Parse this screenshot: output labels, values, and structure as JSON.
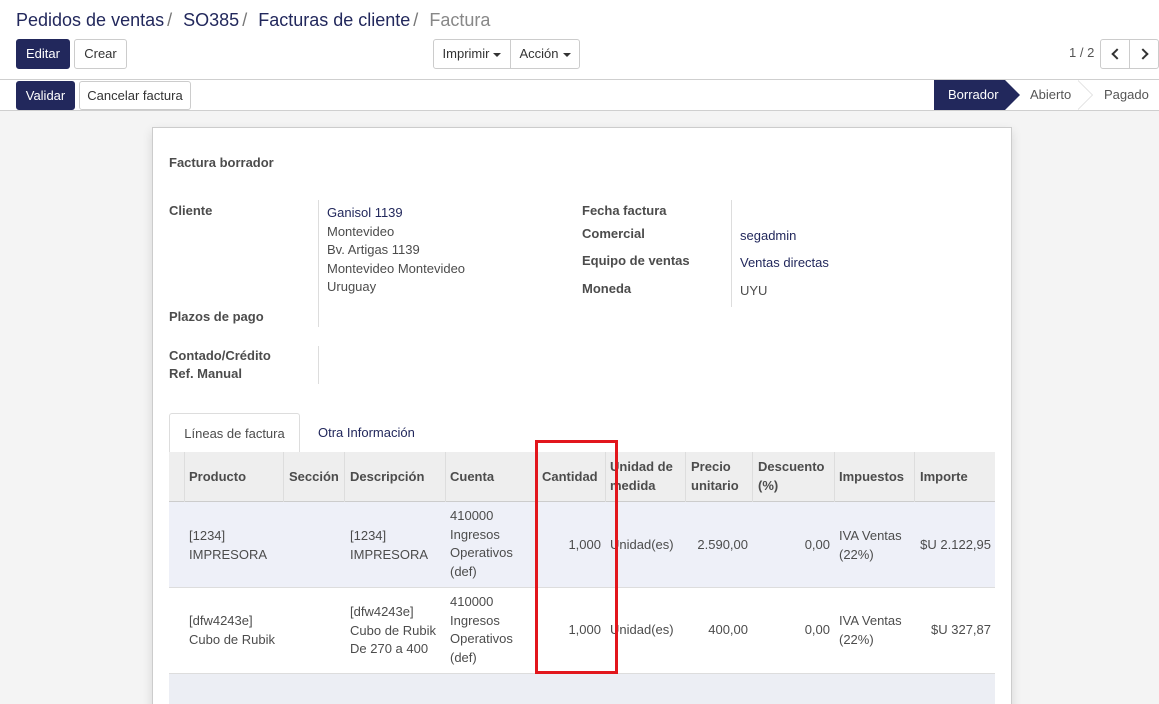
{
  "breadcrumb": {
    "items": [
      "Pedidos de ventas",
      "SO385",
      "Facturas de cliente"
    ],
    "current": "Factura"
  },
  "toolbar": {
    "edit_label": "Editar",
    "create_label": "Crear",
    "print_label": "Imprimir",
    "action_label": "Acción",
    "pager_value": "1 / 2"
  },
  "statusbar": {
    "validate_label": "Validar",
    "cancel_label": "Cancelar factura",
    "stages": [
      "Borrador",
      "Abierto",
      "Pagado"
    ],
    "active_stage": "Borrador"
  },
  "form": {
    "title": "Factura borrador",
    "cliente_label": "Cliente",
    "cliente_lines": [
      "Ganisol 1139",
      "Montevideo",
      "Bv. Artigas 1139",
      "Montevideo Montevideo",
      "Uruguay"
    ],
    "plazos_label": "Plazos de pago",
    "contado_label": "Contado/Crédito",
    "ref_label": "Ref. Manual",
    "fecha_label": "Fecha factura",
    "comercial_label": "Comercial",
    "comercial_value": "segadmin",
    "equipo_label": "Equipo de ventas",
    "equipo_value": "Ventas directas",
    "moneda_label": "Moneda",
    "moneda_value": "UYU"
  },
  "tabs": [
    "Líneas de factura",
    "Otra Información"
  ],
  "table": {
    "headers": {
      "producto": "Producto",
      "seccion": "Sección",
      "descripcion": "Descripción",
      "cuenta": "Cuenta",
      "cantidad": "Cantidad",
      "unidad_1": "Unidad de",
      "unidad_2": "medida",
      "precio_1": "Precio",
      "precio_2": "unitario",
      "descuento_1": "Descuento",
      "descuento_2": "(%)",
      "impuestos": "Impuestos",
      "importe": "Importe"
    },
    "rows": [
      {
        "producto": [
          "[1234]",
          "IMPRESORA"
        ],
        "seccion": "",
        "descripcion": [
          "[1234]",
          "IMPRESORA"
        ],
        "cuenta": [
          "410000",
          "Ingresos",
          "Operativos",
          "(def)"
        ],
        "cantidad": "1,000",
        "unidad": "Unidad(es)",
        "precio": "2.590,00",
        "descuento": "0,00",
        "impuestos": [
          "IVA Ventas",
          "(22%)"
        ],
        "importe": "$U 2.122,95"
      },
      {
        "producto": [
          "[dfw4243e]",
          "Cubo de Rubik"
        ],
        "seccion": "",
        "descripcion": [
          "[dfw4243e]",
          "Cubo de Rubik",
          "De 270 a 400"
        ],
        "cuenta": [
          "410000",
          "Ingresos",
          "Operativos",
          "(def)"
        ],
        "cantidad": "1,000",
        "unidad": "Unidad(es)",
        "precio": "400,00",
        "descuento": "0,00",
        "impuestos": [
          "IVA Ventas",
          "(22%)"
        ],
        "importe": "$U 327,87"
      }
    ]
  },
  "colors": {
    "primary": "#22285c",
    "highlight_box": "#e2161c",
    "row_selected": "#eef0f8"
  }
}
